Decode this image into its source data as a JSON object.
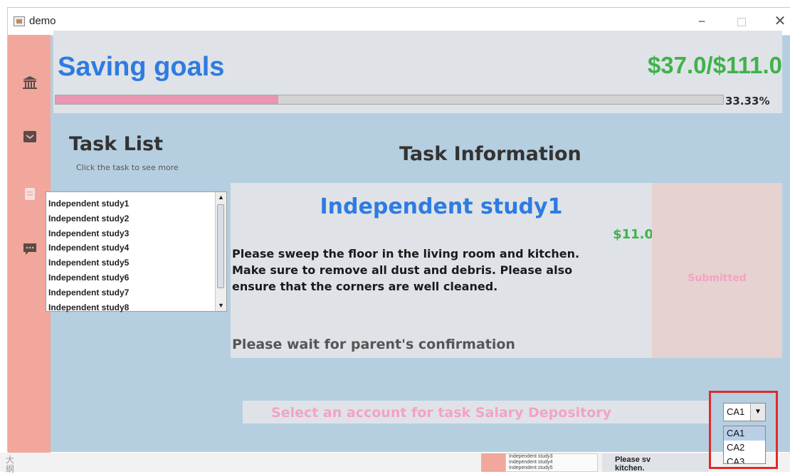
{
  "window": {
    "title": "demo"
  },
  "sidebar": {
    "items": [
      {
        "icon": "bank-icon"
      },
      {
        "icon": "inbox-icon"
      },
      {
        "icon": "clipboard-icon"
      },
      {
        "icon": "chat-icon"
      }
    ]
  },
  "header": {
    "title": "Saving goals",
    "amount": "$37.0/$111.0",
    "progress_percent": 33.33,
    "progress_label": "33.33%"
  },
  "task_list": {
    "title": "Task List",
    "subtitle": "Click the task to see more",
    "items": [
      "Independent study1",
      "Independent study2",
      "Independent study3",
      "Independent study4",
      "Independent study5",
      "Independent study6",
      "Independent study7",
      "Independent study8"
    ]
  },
  "task_info": {
    "title": "Task Information",
    "name": "Independent study1",
    "reward": "$11.0",
    "description": "Please sweep the floor in the living room and kitchen. Make sure to remove all dust and debris. Please also ensure that the corners are well cleaned.",
    "status": "Please wait for parent's confirmation",
    "state": "Submitted"
  },
  "account_select": {
    "label": "Select an account for task Salary Depository",
    "selected": "CA1",
    "options": [
      "CA1",
      "CA2",
      "CA3"
    ]
  },
  "background": {
    "left_text": "大\n纲",
    "list_items": [
      "Independent study3",
      "Independent study4",
      "Independent study5"
    ],
    "text": "Please sv\nkitchen."
  },
  "colors": {
    "sidebar": "#f1a79b",
    "title_blue": "#2f7be0",
    "money_green": "#3fb24a",
    "pink_text": "#f4a3c2",
    "background": "#b5cfe0"
  }
}
